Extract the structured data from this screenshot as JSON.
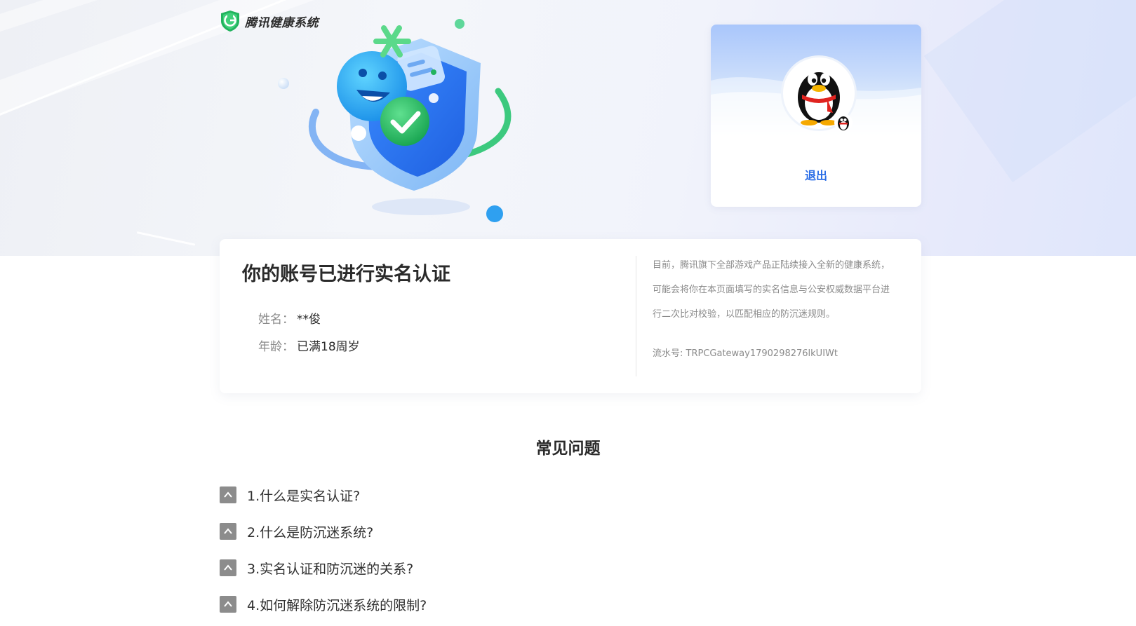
{
  "brand": {
    "name": "腾讯健康系统",
    "logo_icon": "shield-g-logo-icon",
    "accent": "#22b35e"
  },
  "profile": {
    "avatar_icon": "qq-penguin-icon",
    "badge_icon": "qq-penguin-badge-icon",
    "logout_label": "退出",
    "link_color": "#2a6de6"
  },
  "verify": {
    "title": "你的账号已进行实名认证",
    "name_label": "姓名：",
    "name_value": "**俊",
    "age_label": "年龄：",
    "age_value": "已满18周岁",
    "notice": "目前，腾讯旗下全部游戏产品正陆续接入全新的健康系统，可能会将你在本页面填写的实名信息与公安权威数据平台进行二次比对校验，以匹配相应的防沉迷规则。",
    "serial_label": "流水号: ",
    "serial_value": "TRPCGateway1790298276lkUIWt"
  },
  "faq": {
    "title": "常见问题",
    "items": [
      {
        "question": "1.什么是实名认证?"
      },
      {
        "question": "2.什么是防沉迷系统?"
      },
      {
        "question": "3.实名认证和防沉迷的关系?"
      },
      {
        "question": "4.如何解除防沉迷系统的限制?"
      }
    ],
    "toggle_icon": "chevron-up-icon"
  }
}
